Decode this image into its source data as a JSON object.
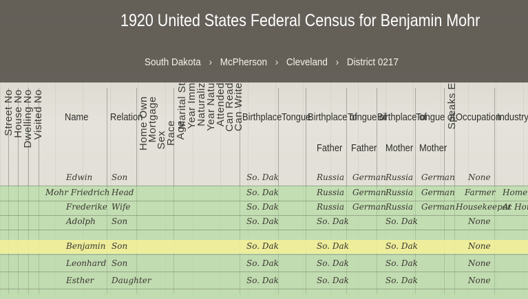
{
  "header": {
    "title": "1920 United States Federal Census for Benjamin Mohr",
    "breadcrumb": [
      "South Dakota",
      "McPherson",
      "Cleveland",
      "District 0217"
    ],
    "separator": "›"
  },
  "columns": {
    "vertical": [
      "Street No",
      "House No",
      "Dwelling No",
      "Visited No",
      "Home Own",
      "Mortgage",
      "Sex",
      "Race",
      "Age",
      "Marital St",
      "Year Imm",
      "Naturaliz",
      "Year Natu",
      "Attended",
      "Can Read",
      "Can Write",
      "Speaks E"
    ],
    "name": "Name",
    "relation": "Relation",
    "birthplace": "Birthplace",
    "tongue": "Tongue",
    "birthplace_of_father": [
      "Birthplace of",
      "Father"
    ],
    "tongue_of_father": [
      "Tongue of",
      "Father"
    ],
    "birthplace_of_mother": [
      "Birthplace of",
      "Mother"
    ],
    "tongue_of_mother": [
      "Tongue of",
      "Mother"
    ],
    "occupation": "Occupation",
    "industry": "Industry"
  },
  "rows": [
    {
      "name": "Edwin",
      "relation": "Son",
      "birthplace": "So. Dak",
      "father": "Russia",
      "tongue_f": "German",
      "mother": "Russia",
      "tongue_m": "German",
      "occupation": "None"
    },
    {
      "name": "Mohr Friedrich",
      "relation": "Head",
      "birthplace": "So. Dak",
      "father": "Russia",
      "tongue_f": "German",
      "mother": "Russia",
      "tongue_m": "German",
      "occupation": "Farmer",
      "industry": "Home Farm"
    },
    {
      "name": "Frederike",
      "relation": "Wife",
      "birthplace": "So. Dak",
      "father": "Russia",
      "tongue_f": "German",
      "mother": "Russia",
      "tongue_m": "German",
      "occupation": "Housekeeper",
      "industry": "At Home"
    },
    {
      "name": "Adolph",
      "relation": "Son",
      "birthplace": "So. Dak",
      "father": "So. Dak",
      "tongue_f": "",
      "mother": "So. Dak",
      "tongue_m": "",
      "occupation": "None"
    },
    {
      "name": "Benjamin",
      "relation": "Son",
      "birthplace": "So. Dak",
      "father": "So. Dak",
      "tongue_f": "",
      "mother": "So. Dak",
      "tongue_m": "",
      "occupation": "None"
    },
    {
      "name": "Leonhard",
      "relation": "Son",
      "birthplace": "So. Dak",
      "father": "So. Dak",
      "tongue_f": "",
      "mother": "So. Dak",
      "tongue_m": "",
      "occupation": "None"
    },
    {
      "name": "Esther",
      "relation": "Daughter",
      "birthplace": "So. Dak",
      "father": "So. Dak",
      "tongue_f": "",
      "mother": "So. Dak",
      "tongue_m": "",
      "occupation": "None"
    }
  ]
}
